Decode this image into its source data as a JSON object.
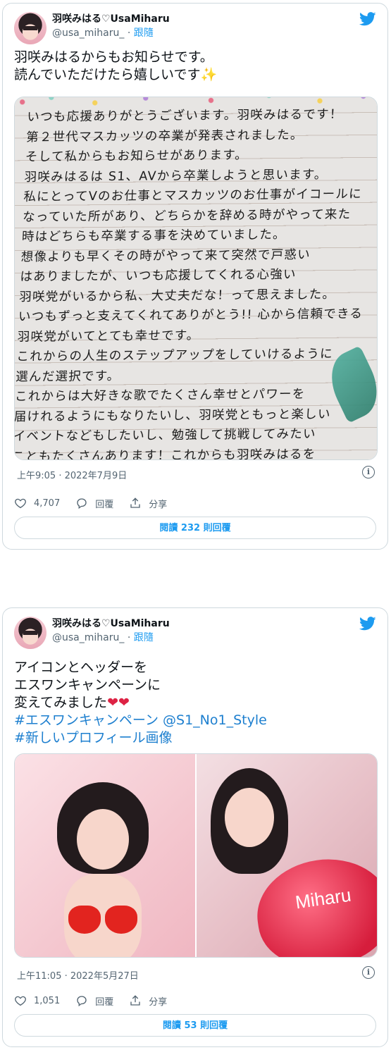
{
  "colors": {
    "link": "#1d9bf0",
    "hashtag": "#1d7fcf",
    "text": "#0f1419",
    "muted": "#536471",
    "border": "#cfd9de"
  },
  "tweets": [
    {
      "display_name": "羽咲みはる♡UsaMiharu",
      "handle": "@usa_miharu_",
      "follow_label": "跟隨",
      "text_line1": "羽咲みはるからもお知らせです。",
      "text_line2": "読んでいただけたら嬉しいです",
      "emoji": "✨",
      "media_letter_lines": [
        "いつも応援ありがとうございます。羽咲みはるです！",
        "第２世代マスカッツの卒業が発表されました。",
        "そして私からもお知らせがあります。",
        "羽咲みはるは S1、AVから卒業しようと思います。",
        "私にとってVのお仕事とマスカッツのお仕事がイコールに",
        "なっていた所があり、どちらかを辞める時がやって来た",
        "時はどちらも卒業する事を決めていました。",
        "想像よりも早くその時がやって来て突然で戸惑い",
        "はありましたが、いつも応援してくれる心強い",
        "羽咲党がいるから私、大丈夫だな！って思えました。",
        "いつもずっと支えてくれてありがとう!! 心から信頼できる",
        "羽咲党がいてとても幸せです。",
        "これからの人生のステップアップをしていけるように",
        "選んだ選択です。",
        "これからは大好きな歌でたくさん幸せとパワーを",
        "届けれるようにもなりたいし、羽咲党ともっと楽しい",
        "イベントなどもしたいし、勉強して挑戦してみたい",
        "こともたくさんあります！これからも羽咲みはるを"
      ],
      "timestamp": "上午9:05 · 2022年7月9日",
      "likes": "4,707",
      "reply_label": "回覆",
      "share_label": "分享",
      "read_replies_prefix": "閱讀",
      "read_replies_count": "232",
      "read_replies_suffix": "則回覆"
    },
    {
      "display_name": "羽咲みはる♡UsaMiharu",
      "handle": "@usa_miharu_",
      "follow_label": "跟隨",
      "text_line1": "アイコンとヘッダーを",
      "text_line2": "エスワンキャンペーンに",
      "text_line3": "変えてみました",
      "emoji": "❤❤",
      "hashtag_line1": "#エスワンキャンペーン @S1_No1_Style",
      "hashtag_line2": "#新しいプロフィール画像",
      "balloon_text": "Miharu",
      "timestamp": "上午11:05 · 2022年5月27日",
      "likes": "1,051",
      "reply_label": "回覆",
      "share_label": "分享",
      "read_replies_prefix": "閱讀",
      "read_replies_count": "53",
      "read_replies_suffix": "則回覆"
    }
  ],
  "icons": {
    "bird": "twitter-bird-icon",
    "like": "heart-outline-icon",
    "reply": "speech-bubble-icon",
    "share": "share-upload-icon",
    "info": "info-icon"
  }
}
